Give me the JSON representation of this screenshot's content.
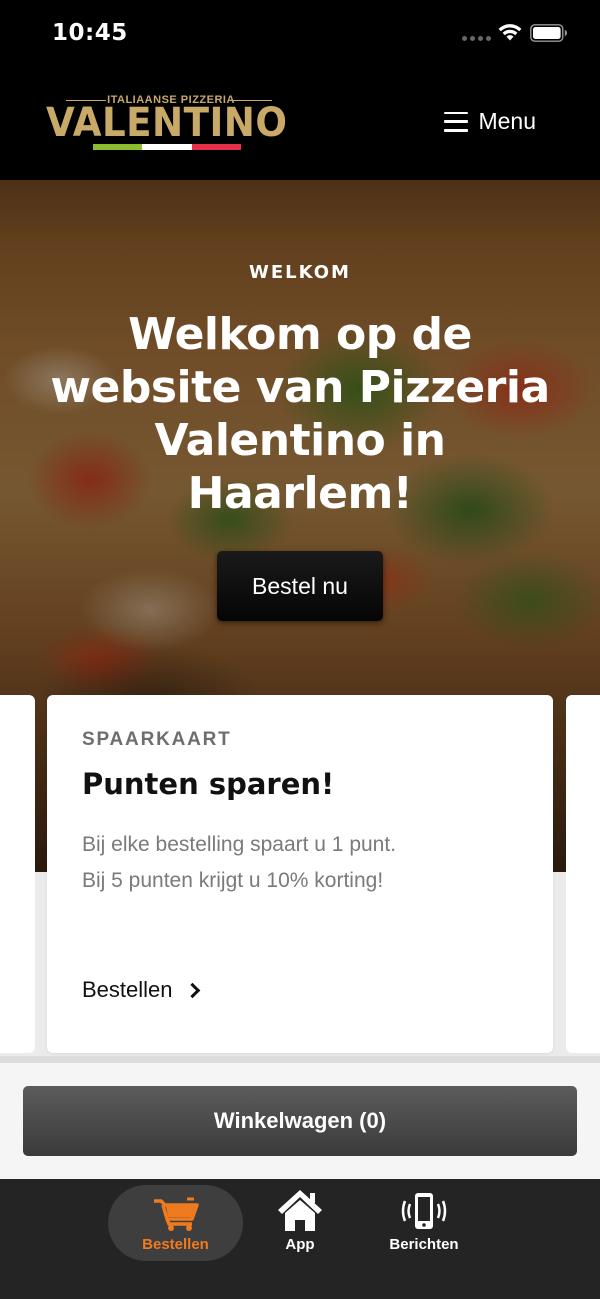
{
  "status_bar": {
    "time": "10:45"
  },
  "header": {
    "logo_top": "ITALIAANSE PIZZERIA",
    "logo_name": "VALENTINO",
    "menu_label": "Menu",
    "flag_colors": [
      "#8bbd2f",
      "#ffffff",
      "#e5304a"
    ]
  },
  "hero": {
    "label": "WELKOM",
    "title": "Welkom op de website van Pizzeria Valentino in Haarlem!",
    "order_button": "Bestel nu"
  },
  "card": {
    "eyebrow": "SPAARKAART",
    "title": "Punten sparen!",
    "line1": "Bij elke bestelling spaart u 1 punt.",
    "line2": "Bij 5 punten krijgt u 10% korting!",
    "link": "Bestellen"
  },
  "cart": {
    "label": "Winkelwagen (0)"
  },
  "tabs": {
    "order": "Bestellen",
    "app": "App",
    "messages": "Berichten"
  },
  "colors": {
    "accent": "#f07a1e",
    "logo_gold": "#c9a968"
  }
}
